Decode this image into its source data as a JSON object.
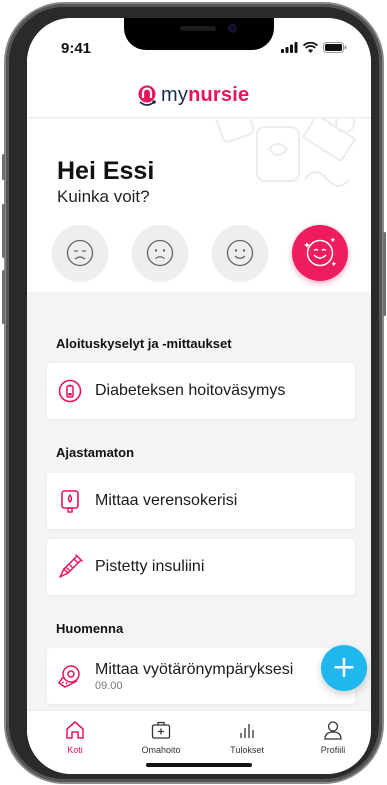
{
  "status": {
    "time": "9:41"
  },
  "brand": {
    "my": "my",
    "nursie": "nursie",
    "accent": "#e8135a"
  },
  "hero": {
    "greeting": "Hei Essi",
    "question": "Kuinka voit?",
    "moods": [
      "sad",
      "frowning",
      "smiling",
      "very-happy"
    ],
    "selected_mood": "very-happy"
  },
  "sections": [
    {
      "title": "Aloituskyselyt ja -mittaukset",
      "items": [
        {
          "label": "Diabeteksen hoitoväsymys",
          "icon": "battery-icon"
        }
      ]
    },
    {
      "title": "Ajastamaton",
      "items": [
        {
          "label": "Mittaa verensokerisi",
          "icon": "glucometer-icon"
        },
        {
          "label": "Pistetty insuliini",
          "icon": "syringe-icon"
        }
      ]
    },
    {
      "title": "Huomenna",
      "items": [
        {
          "label": "Mittaa vyötärönympäryksesi",
          "time": "09.00",
          "icon": "tape-measure-icon"
        }
      ]
    }
  ],
  "fab": {
    "symbol": "+",
    "color": "#1fb7ee"
  },
  "tabs": [
    {
      "label": "Koti",
      "icon": "home-icon",
      "active": true
    },
    {
      "label": "Omahoito",
      "icon": "medical-kit-icon",
      "active": false
    },
    {
      "label": "Tulokset",
      "icon": "bar-chart-icon",
      "active": false
    },
    {
      "label": "Profiili",
      "icon": "user-icon",
      "active": false
    }
  ]
}
